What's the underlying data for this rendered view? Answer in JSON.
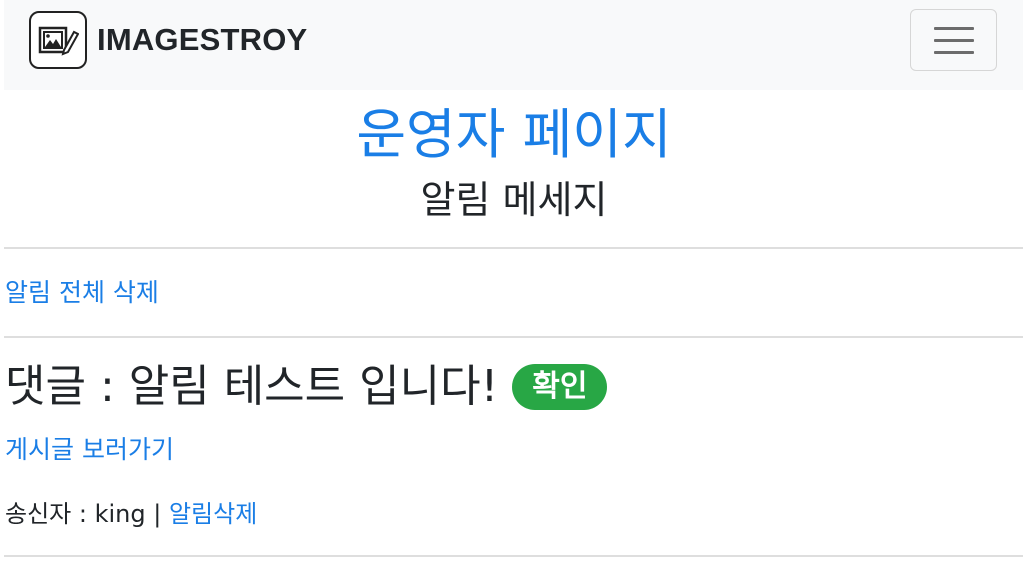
{
  "navbar": {
    "brand_text": "IMAGESTROY",
    "logo_icon": "image-edit-icon",
    "menu_icon": "hamburger-menu-icon"
  },
  "page": {
    "title": "운영자 페이지",
    "subtitle": "알림 메세지"
  },
  "actions": {
    "delete_all_label": "알림 전체 삭제"
  },
  "notification": {
    "message": "댓글 : 알림 테스트 입니다!",
    "badge_label": "확인",
    "view_post_label": "게시글 보러가기",
    "sender_prefix": "송신자 : king",
    "separator": " | ",
    "delete_label": "알림삭제"
  },
  "colors": {
    "link": "#1a7ee6",
    "badge": "#28a745",
    "navbar_bg": "#f8f9fa"
  }
}
